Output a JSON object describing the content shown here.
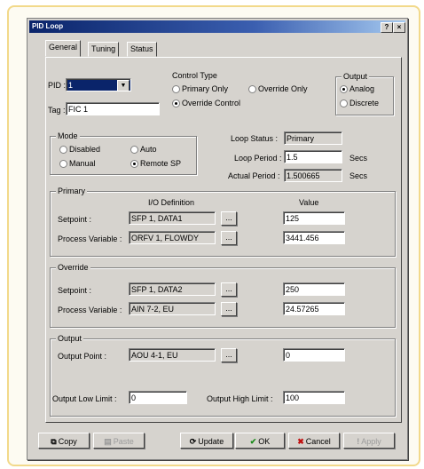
{
  "window": {
    "title": "PID Loop",
    "help_btn": "?",
    "close_btn": "×"
  },
  "tabs": [
    "General",
    "Tuning",
    "Status"
  ],
  "pid": {
    "label": "PID :",
    "value": "1"
  },
  "tag": {
    "label": "Tag :",
    "value": "FIC 1"
  },
  "control_type": {
    "caption": "Control Type",
    "options": [
      "Primary Only",
      "Override Only",
      "Override Control"
    ],
    "selected": "Override Control"
  },
  "output_type": {
    "caption": "Output",
    "options": [
      "Analog",
      "Discrete"
    ],
    "selected": "Analog"
  },
  "mode": {
    "caption": "Mode",
    "options": [
      "Disabled",
      "Auto",
      "Manual",
      "Remote SP"
    ],
    "selected": "Remote SP"
  },
  "loop_status": {
    "label": "Loop Status :",
    "value": "Primary"
  },
  "loop_period": {
    "label": "Loop Period :",
    "value": "1.5",
    "unit": "Secs"
  },
  "actual_period": {
    "label": "Actual Period :",
    "value": "1.500665",
    "unit": "Secs"
  },
  "primary": {
    "caption": "Primary",
    "col_def": "I/O Definition",
    "col_value": "Value",
    "setpoint": {
      "label": "Setpoint :",
      "io": "SFP 1, DATA1",
      "value": "125"
    },
    "process": {
      "label": "Process Variable :",
      "io": "ORFV 1, FLOWDY",
      "value": "3441.456"
    }
  },
  "override": {
    "caption": "Override",
    "setpoint": {
      "label": "Setpoint :",
      "io": "SFP 1, DATA2",
      "value": "250"
    },
    "process": {
      "label": "Process Variable :",
      "io": "AIN 7-2, EU",
      "value": "24.57265"
    }
  },
  "output": {
    "caption": "Output",
    "point": {
      "label": "Output Point :",
      "io": "AOU 4-1, EU",
      "value": "0"
    },
    "low": {
      "label": "Output Low Limit :",
      "value": "0"
    },
    "high": {
      "label": "Output High Limit :",
      "value": "100"
    }
  },
  "browse_label": "...",
  "buttons": {
    "copy": "Copy",
    "paste": "Paste",
    "update": "Update",
    "ok": "OK",
    "cancel": "Cancel",
    "apply": "Apply"
  }
}
